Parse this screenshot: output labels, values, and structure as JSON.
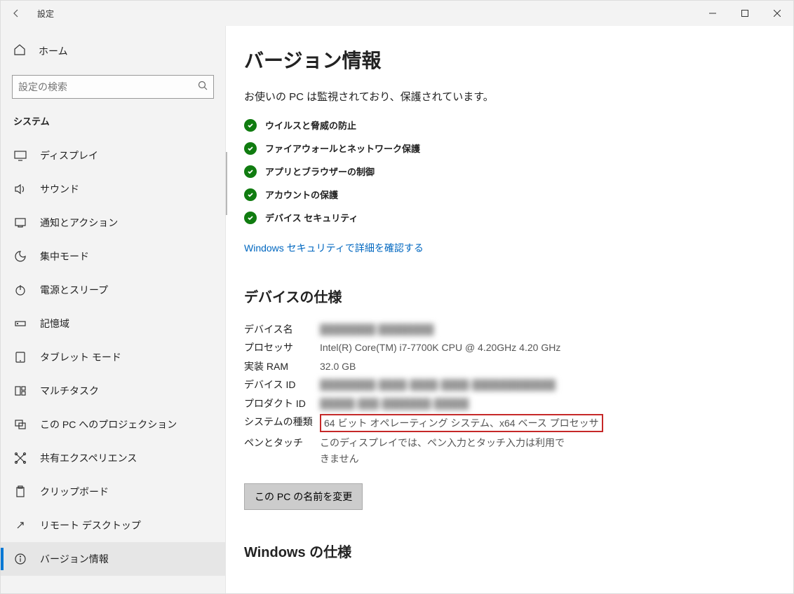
{
  "window": {
    "title": "設定"
  },
  "sidebar": {
    "home": "ホーム",
    "search_placeholder": "設定の検索",
    "section": "システム",
    "items": [
      {
        "label": "ディスプレイ",
        "icon": "display"
      },
      {
        "label": "サウンド",
        "icon": "sound"
      },
      {
        "label": "通知とアクション",
        "icon": "notification"
      },
      {
        "label": "集中モード",
        "icon": "focus"
      },
      {
        "label": "電源とスリープ",
        "icon": "power"
      },
      {
        "label": "記憶域",
        "icon": "storage"
      },
      {
        "label": "タブレット モード",
        "icon": "tablet"
      },
      {
        "label": "マルチタスク",
        "icon": "multitask"
      },
      {
        "label": "この PC へのプロジェクション",
        "icon": "projection"
      },
      {
        "label": "共有エクスペリエンス",
        "icon": "share"
      },
      {
        "label": "クリップボード",
        "icon": "clipboard"
      },
      {
        "label": "リモート デスクトップ",
        "icon": "remote"
      },
      {
        "label": "バージョン情報",
        "icon": "info",
        "selected": true
      }
    ]
  },
  "main": {
    "title": "バージョン情報",
    "protection_heading": "お使いの PC は監視されており、保護されています。",
    "checks": [
      "ウイルスと脅威の防止",
      "ファイアウォールとネットワーク保護",
      "アプリとブラウザーの制御",
      "アカウントの保護",
      "デバイス セキュリティ"
    ],
    "security_link": "Windows セキュリティで詳細を確認する",
    "device_spec_title": "デバイスの仕様",
    "specs": {
      "device_name_label": "デバイス名",
      "device_name_value": "████████ ████████",
      "processor_label": "プロセッサ",
      "processor_value": "Intel(R) Core(TM) i7-7700K CPU @ 4.20GHz   4.20 GHz",
      "ram_label": "実装 RAM",
      "ram_value": "32.0 GB",
      "device_id_label": "デバイス ID",
      "device_id_value": "████████-████-████-████-████████████",
      "product_id_label": "プロダクト ID",
      "product_id_value": "█████-███-███████-█████",
      "system_type_label": "システムの種類",
      "system_type_value": "64 ビット オペレーティング システム、x64 ベース プロセッサ",
      "pen_touch_label": "ペンとタッチ",
      "pen_touch_value": "このディスプレイでは、ペン入力とタッチ入力は利用できません"
    },
    "rename_button": "この PC の名前を変更",
    "windows_spec_title": "Windows の仕様"
  }
}
